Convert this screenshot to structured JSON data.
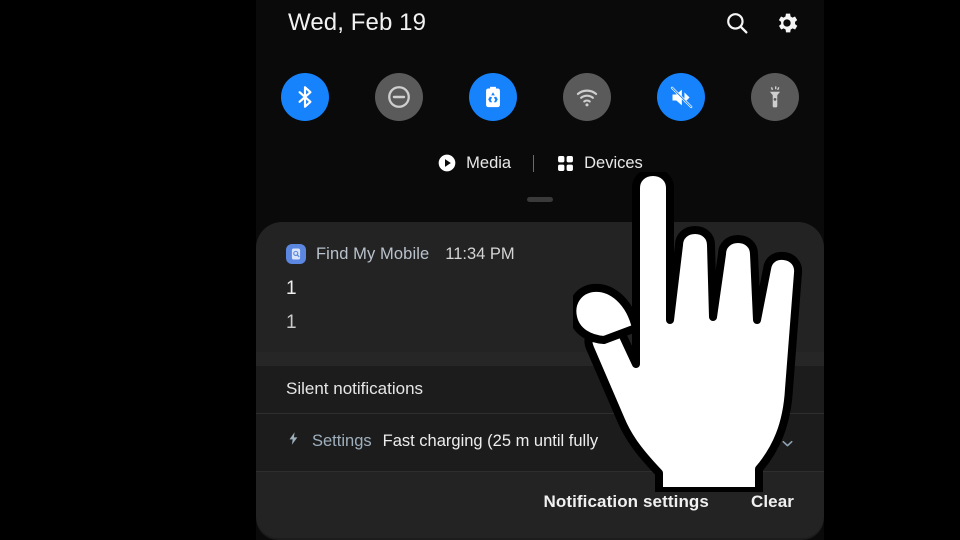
{
  "panel": {
    "date": "Wed, Feb 19",
    "header_icons": [
      {
        "name": "search-icon",
        "label": "Search"
      },
      {
        "name": "gear-icon",
        "label": "Settings"
      }
    ],
    "toggles": [
      {
        "name": "bluetooth-toggle",
        "label": "Bluetooth",
        "state": "on",
        "icon": "bluetooth-icon"
      },
      {
        "name": "do-not-disturb-toggle",
        "label": "Do not disturb",
        "state": "off",
        "icon": "do-not-disturb-icon"
      },
      {
        "name": "power-saving-toggle",
        "label": "Power saving",
        "state": "on",
        "icon": "battery-recycle-icon"
      },
      {
        "name": "wifi-toggle",
        "label": "Wi-Fi",
        "state": "off",
        "icon": "wifi-icon"
      },
      {
        "name": "mute-toggle",
        "label": "Mute",
        "state": "on",
        "icon": "volume-mute-icon"
      },
      {
        "name": "flashlight-toggle",
        "label": "Flashlight",
        "state": "off",
        "icon": "flashlight-icon"
      }
    ],
    "media_row": {
      "media_label": "Media",
      "devices_label": "Devices"
    },
    "notification": {
      "app_name": "Find My Mobile",
      "time": "11:34 PM",
      "title": "1",
      "body": "1"
    },
    "silent_section": {
      "header": "Silent notifications",
      "rows": [
        {
          "app_name": "Settings",
          "text": "Fast charging (25 m until fully",
          "icon": "lightning-bolt-icon",
          "expand_icon": "chevron-down-icon"
        }
      ]
    },
    "actions": {
      "notification_settings": "Notification settings",
      "clear": "Clear"
    }
  },
  "cursor": {
    "name": "pointing-hand-cursor"
  },
  "colors": {
    "accent_on": "#1682fb",
    "toggle_off": "#5a5a5a",
    "panel_bg": "#0a0a0a",
    "card_bg": "#232323",
    "stack_bg": "#1c1c1c",
    "app_accent": "#5b87e0"
  }
}
